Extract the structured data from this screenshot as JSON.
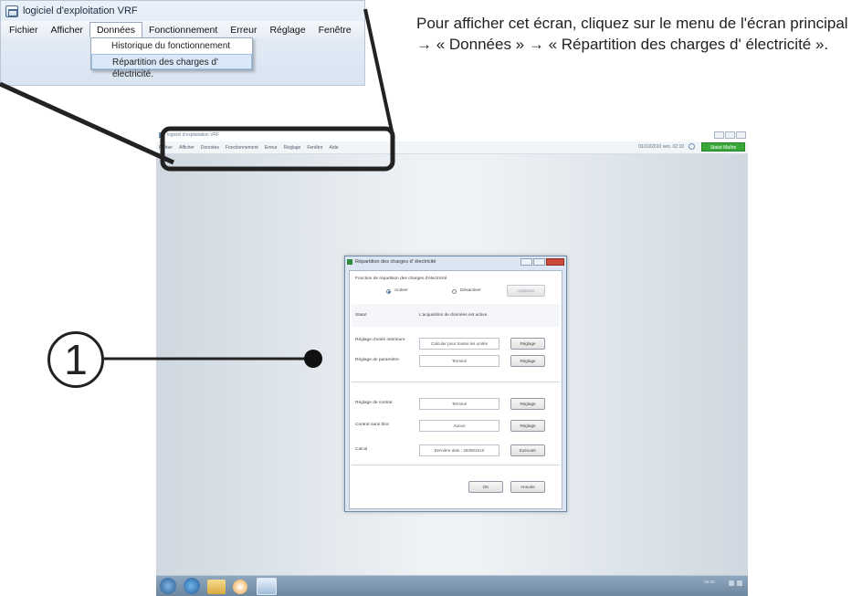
{
  "inset": {
    "title": "logiciel d'exploitation VRF",
    "menu": [
      "Fichier",
      "Afficher",
      "Données",
      "Fonctionnement",
      "Erreur",
      "Réglage",
      "Fenêtre",
      "Aide"
    ],
    "dropdown": [
      "Historique du fonctionnement",
      "Répartition des charges d' électricité."
    ]
  },
  "instruction": "Pour afficher cet écran, cliquez sur le menu de l'écran principal → « Données » → « Répartition des charges d' électricité ».",
  "callout_number": "1",
  "screen": {
    "title": "logiciel d'exploitation VRF",
    "menu": [
      "Fichier",
      "Afficher",
      "Données",
      "Fonctionnement",
      "Erreur",
      "Réglage",
      "Fenêtre",
      "Aide"
    ],
    "datetime": "01/10/2010 ven. 02:10",
    "status_button": "Statut Maître",
    "clock": "02:10"
  },
  "dialog": {
    "title": "Répartition des charges d' électricité",
    "function_label": "Fonction de répartition des charges d'électricité",
    "radio_on": "Activer",
    "radio_off": "Désactiver",
    "apply_button": "Appliquer",
    "status_label": "Statut",
    "status_value": "L'acquisition de données est active.",
    "rows": [
      {
        "label": "Réglage d'unité intérieure",
        "value": "Calculer pour toutes les unités",
        "button": "Réglage"
      },
      {
        "label": "Réglage de paramètre",
        "value": "Terminé",
        "button": "Réglage"
      },
      {
        "label": "Réglage de contrat",
        "value": "Terminé",
        "button": "Réglage"
      },
      {
        "label": "Contrat sans bloc",
        "value": "Aucun",
        "button": "Réglage"
      },
      {
        "label": "Calcul",
        "value": "Dernière date : 28/09/2010",
        "button": "Exécuter"
      }
    ],
    "ok_button": "OK",
    "cancel_button": "Annuler"
  }
}
